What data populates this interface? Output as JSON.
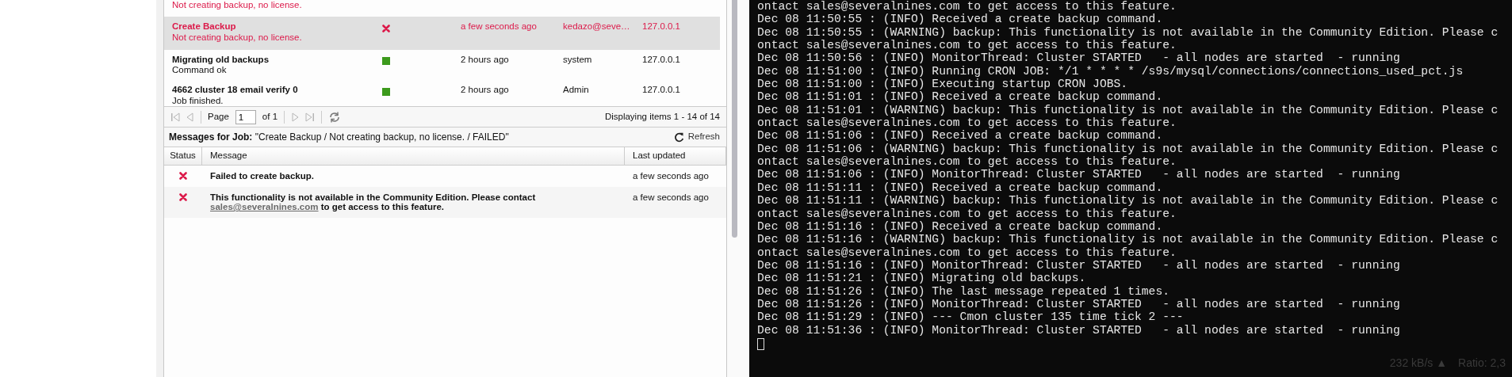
{
  "jobs": [
    {
      "message": "Not creating backup, no license.",
      "kind": "failed",
      "selected": false
    },
    {
      "title": "Create Backup",
      "message": "Not creating backup, no license.",
      "kind": "failed",
      "time": "a few seconds ago",
      "user": "kedazo@seve…",
      "ip": "127.0.0.1",
      "selected": true
    },
    {
      "title": "Migrating old backups",
      "message": "Command ok",
      "kind": "ok",
      "time": "2 hours ago",
      "user": "system",
      "ip": "127.0.0.1",
      "selected": false
    },
    {
      "title": "4662 cluster 18 email verify 0",
      "message": "Job finished.",
      "kind": "ok",
      "time": "2 hours ago",
      "user": "Admin",
      "ip": "127.0.0.1",
      "selected": false
    }
  ],
  "pager": {
    "page_label": "Page",
    "page_value": "1",
    "of_label": "of 1",
    "display": "Displaying items 1 - 14 of 14"
  },
  "messages": {
    "title_label": "Messages for Job:",
    "title_value": "\"Create Backup / Not creating backup, no license. / FAILED\"",
    "refresh": "Refresh",
    "columns": [
      "Status",
      "Message",
      "Last updated"
    ],
    "rows": [
      {
        "kind": "failed",
        "text": "Failed to create backup.",
        "time": "a few seconds ago"
      },
      {
        "kind": "failed",
        "text": "This functionality is not available in the Community Edition. Please contact",
        "link": "sales@severalnines.com",
        "text_after": " to get access to this feature.",
        "time": "a few seconds ago"
      }
    ]
  },
  "terminal": {
    "lines": [
      "ontact sales@severalnines.com to get access to this feature.",
      "Dec 08 11:50:55 : (INFO) Received a create backup command.",
      "Dec 08 11:50:55 : (WARNING) backup: This functionality is not available in the Community Edition. Please c",
      "ontact sales@severalnines.com to get access to this feature.",
      "Dec 08 11:50:56 : (INFO) MonitorThread: Cluster STARTED   - all nodes are started  - running",
      "Dec 08 11:51:00 : (INFO) Running CRON JOB: */1 * * * * /s9s/mysql/connections/connections_used_pct.js",
      "Dec 08 11:51:00 : (INFO) Executing startup CRON JOBS.",
      "Dec 08 11:51:01 : (INFO) Received a create backup command.",
      "Dec 08 11:51:01 : (WARNING) backup: This functionality is not available in the Community Edition. Please c",
      "ontact sales@severalnines.com to get access to this feature.",
      "Dec 08 11:51:06 : (INFO) Received a create backup command.",
      "Dec 08 11:51:06 : (WARNING) backup: This functionality is not available in the Community Edition. Please c",
      "ontact sales@severalnines.com to get access to this feature.",
      "Dec 08 11:51:06 : (INFO) MonitorThread: Cluster STARTED   - all nodes are started  - running",
      "Dec 08 11:51:11 : (INFO) Received a create backup command.",
      "Dec 08 11:51:11 : (WARNING) backup: This functionality is not available in the Community Edition. Please c",
      "ontact sales@severalnines.com to get access to this feature.",
      "Dec 08 11:51:16 : (INFO) Received a create backup command.",
      "Dec 08 11:51:16 : (WARNING) backup: This functionality is not available in the Community Edition. Please c",
      "ontact sales@severalnines.com to get access to this feature.",
      "Dec 08 11:51:16 : (INFO) MonitorThread: Cluster STARTED   - all nodes are started  - running",
      "Dec 08 11:51:21 : (INFO) Migrating old backups.",
      "Dec 08 11:51:26 : (INFO) The last message repeated 1 times.",
      "Dec 08 11:51:26 : (INFO) MonitorThread: Cluster STARTED   - all nodes are started  - running",
      "Dec 08 11:51:29 : (INFO) --- Cmon cluster 135 time tick 2 ---",
      "Dec 08 11:51:36 : (INFO) MonitorThread: Cluster STARTED   - all nodes are started  - running"
    ],
    "overlay": {
      "speed": "232 kB/s ▲",
      "ratio": "Ratio: 2,3"
    }
  }
}
